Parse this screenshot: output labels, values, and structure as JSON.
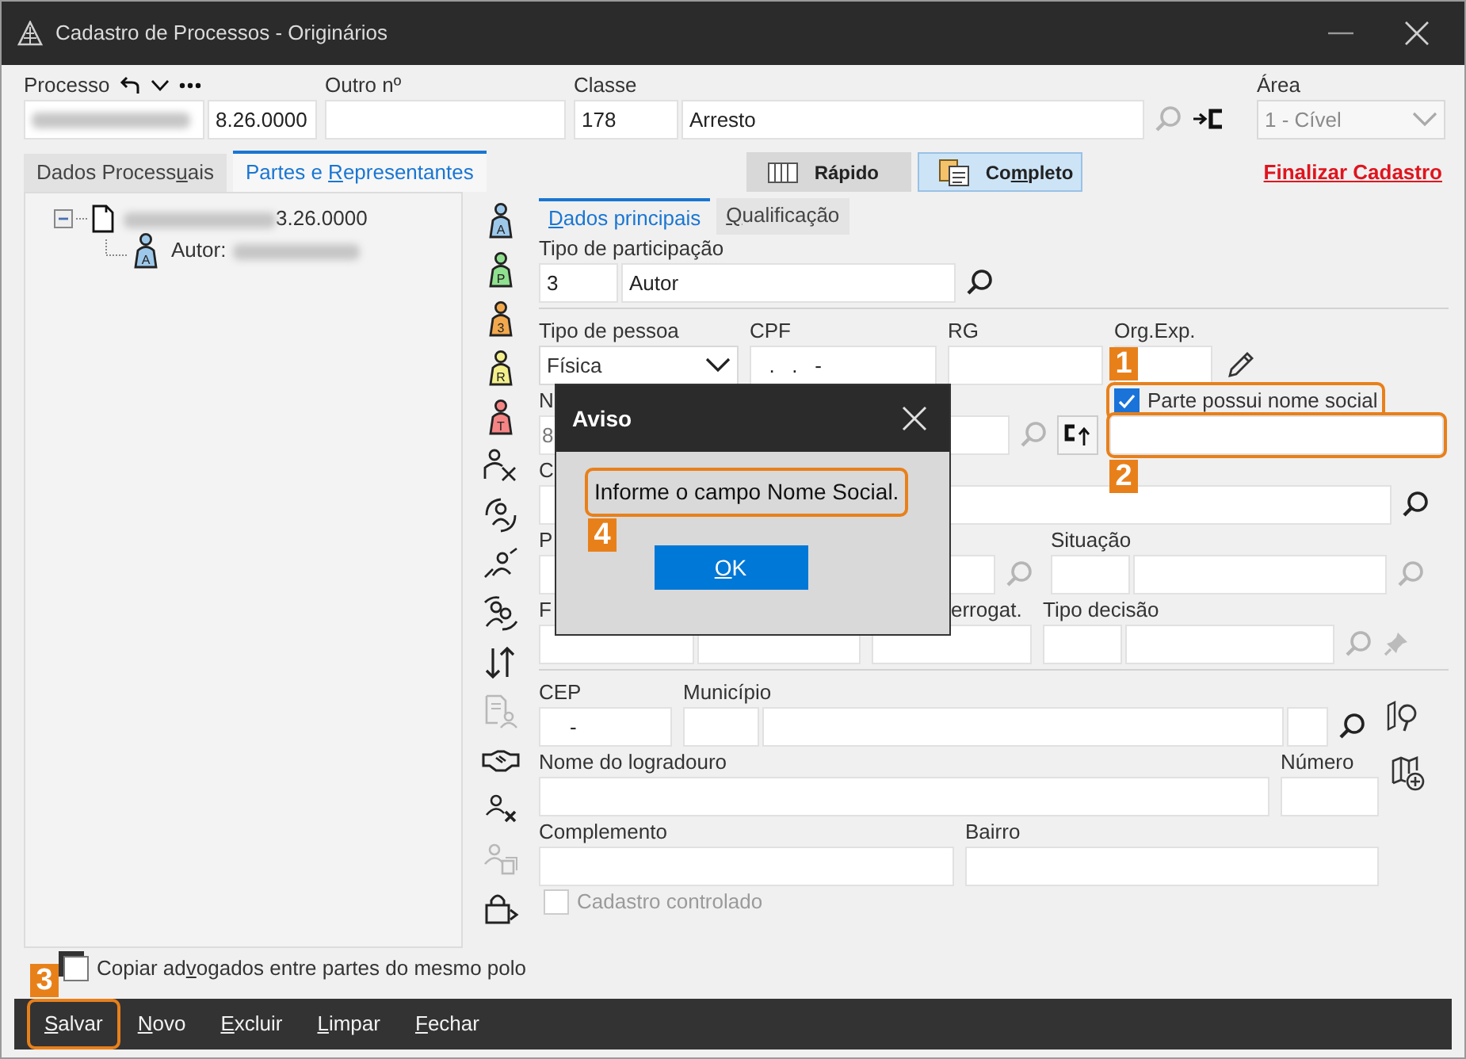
{
  "window": {
    "title": "Cadastro de Processos - Originários"
  },
  "header": {
    "groups": [
      {
        "label": "Processo",
        "tools": true,
        "controls": [
          {
            "kind": "field",
            "redacted": true
          },
          {
            "kind": "field",
            "value": "8.26.0000"
          }
        ]
      },
      {
        "label": "Outro nº",
        "controls": [
          {
            "kind": "field"
          }
        ]
      },
      {
        "label": "Classe",
        "controls": [
          {
            "kind": "field",
            "value": "178"
          },
          {
            "kind": "field",
            "value": "Arresto"
          },
          {
            "kind": "search",
            "disabled": true
          },
          {
            "kind": "link-button"
          }
        ]
      },
      {
        "label": "Área",
        "controls": [
          {
            "kind": "select",
            "value": "1 - Cível",
            "disabled": true
          }
        ]
      }
    ]
  },
  "main_tabs": [
    {
      "label": {
        "before": "Dados Process",
        "key": "u",
        "after": "ais"
      },
      "selected": false
    },
    {
      "label": {
        "before": "Partes e ",
        "key": "R",
        "after": "epresentantes"
      },
      "selected": true
    }
  ],
  "view_buttons": [
    {
      "label": {
        "before": "Rápido"
      },
      "kind": "list",
      "selected": false
    },
    {
      "label": {
        "before": "Co",
        "key": "m",
        "after": "pleto"
      },
      "kind": "cards",
      "selected": true
    }
  ],
  "finalize_link": "Finalizar Cadastro",
  "tree": [
    {
      "label": "3.26.0000",
      "redacted": true,
      "expanded": true,
      "children": [
        {
          "label": "Autor:",
          "icon_letter": "A",
          "redacted": true
        }
      ]
    }
  ],
  "side_tools": [
    {
      "kind": "pawn",
      "letter": "A",
      "color": "#9dc8ea",
      "disabled": false
    },
    {
      "kind": "pawn",
      "letter": "P",
      "color": "#8fe08f",
      "disabled": false
    },
    {
      "kind": "pawn",
      "letter": "3",
      "color": "#f2a94e",
      "disabled": false
    },
    {
      "kind": "pawn",
      "letter": "R",
      "color": "#f3f08c",
      "disabled": false
    },
    {
      "kind": "pawn",
      "letter": "T",
      "color": "#f58585",
      "disabled": false
    },
    {
      "kind": "person-x",
      "disabled": false
    },
    {
      "kind": "person-cycle",
      "disabled": false
    },
    {
      "kind": "person-arrows",
      "disabled": false
    },
    {
      "kind": "persons-swap",
      "disabled": false
    },
    {
      "kind": "sort-arrows",
      "disabled": false
    },
    {
      "kind": "doc-person",
      "disabled": true
    },
    {
      "kind": "handshake",
      "disabled": false
    },
    {
      "kind": "user-remove",
      "disabled": false
    },
    {
      "kind": "user-copy",
      "disabled": true
    },
    {
      "kind": "lock-arrow",
      "disabled": false
    }
  ],
  "sub_tabs": [
    {
      "label": {
        "key": "D",
        "after": "ados principais"
      },
      "selected": true
    },
    {
      "label": {
        "key": "Q",
        "after": "ualificação"
      },
      "selected": false
    }
  ],
  "form_rows": [
    {
      "kind": "fields",
      "groups": [
        {
          "label": "Tipo de participação",
          "controls": [
            {
              "kind": "field",
              "value": "3"
            },
            {
              "kind": "field",
              "value": "Autor"
            },
            {
              "kind": "search",
              "disabled": false
            }
          ]
        }
      ]
    },
    {
      "kind": "divider"
    },
    {
      "kind": "fields",
      "groups": [
        {
          "label": "Tipo de pessoa",
          "controls": [
            {
              "kind": "select",
              "value": "Física",
              "disabled": false
            }
          ]
        },
        {
          "label": "CPF",
          "controls": [
            {
              "kind": "field",
              "value": "  .   .   -"
            }
          ]
        },
        {
          "label": "RG",
          "controls": [
            {
              "kind": "field"
            }
          ]
        },
        {
          "label": "Org.Exp.",
          "controls": [
            {
              "kind": "field"
            },
            {
              "kind": "pencil"
            }
          ]
        }
      ]
    },
    {
      "kind": "fields",
      "groups": [
        {
          "label": "N",
          "controls": [
            {
              "kind": "field",
              "value": "8",
              "muted": true
            },
            {
              "kind": "field"
            },
            {
              "kind": "search",
              "disabled": true
            },
            {
              "kind": "tag-button"
            }
          ]
        },
        {
          "checkbox": {
            "label": "Parte possui nome social",
            "checked": true,
            "disabled": false,
            "annotation": {
              "number": "1"
            }
          },
          "controls": [
            {
              "kind": "field",
              "annotation": {
                "number": "2"
              }
            }
          ]
        }
      ]
    },
    {
      "kind": "fields",
      "groups": [
        {
          "label": "C",
          "controls": [
            {
              "kind": "field"
            },
            {
              "kind": "search",
              "disabled": false
            }
          ]
        }
      ]
    },
    {
      "kind": "fields",
      "groups": [
        {
          "label": "P",
          "controls": [
            {
              "kind": "field"
            },
            {
              "kind": "search",
              "disabled": true
            }
          ]
        },
        {
          "label": "Situação",
          "controls": [
            {
              "kind": "field"
            },
            {
              "kind": "field"
            },
            {
              "kind": "search",
              "disabled": true
            }
          ]
        }
      ]
    },
    {
      "kind": "fields",
      "groups": [
        {
          "label": "F",
          "controls": [
            {
              "kind": "field"
            },
            {
              "kind": "field"
            }
          ]
        },
        {
          "label": "errogat.",
          "controls": [
            {
              "kind": "field"
            }
          ]
        },
        {
          "label": "Tipo decisão",
          "controls": [
            {
              "kind": "field"
            },
            {
              "kind": "field"
            },
            {
              "kind": "search",
              "disabled": true
            },
            {
              "kind": "pin",
              "disabled": true
            }
          ]
        }
      ]
    },
    {
      "kind": "divider"
    },
    {
      "kind": "fields",
      "groups": [
        {
          "label": "CEP",
          "controls": [
            {
              "kind": "field",
              "value": "    -"
            }
          ]
        },
        {
          "label": "Município",
          "controls": [
            {
              "kind": "field"
            },
            {
              "kind": "field"
            },
            {
              "kind": "field"
            },
            {
              "kind": "search",
              "disabled": false
            }
          ]
        },
        {
          "controls": [
            {
              "kind": "map-pin"
            }
          ]
        }
      ]
    },
    {
      "kind": "fields",
      "groups": [
        {
          "label": "Nome do logradouro",
          "controls": [
            {
              "kind": "field"
            }
          ]
        },
        {
          "label": "Número",
          "controls": [
            {
              "kind": "field"
            }
          ]
        },
        {
          "controls": [
            {
              "kind": "map-plus"
            }
          ]
        }
      ]
    },
    {
      "kind": "fields",
      "groups": [
        {
          "label": "Complemento",
          "controls": [
            {
              "kind": "field"
            }
          ]
        },
        {
          "label": "Bairro",
          "controls": [
            {
              "kind": "field"
            }
          ]
        }
      ]
    },
    {
      "kind": "fields",
      "groups": [
        {
          "checkbox": {
            "label": "Cadastro controlado",
            "checked": false,
            "disabled": true
          }
        }
      ]
    }
  ],
  "copy_checkbox": {
    "label": {
      "before": "Copiar ad",
      "key": "v",
      "after": "ogados entre partes do mesmo polo"
    },
    "checked": false
  },
  "actions": [
    {
      "label": {
        "key": "S",
        "after": "alvar"
      },
      "annotation": {
        "number": "3"
      }
    },
    {
      "label": {
        "key": "N",
        "after": "ovo"
      }
    },
    {
      "label": {
        "key": "E",
        "after": "xcluir"
      }
    },
    {
      "label": {
        "key": "L",
        "after": "impar"
      }
    },
    {
      "label": {
        "key": "F",
        "after": "echar"
      }
    }
  ],
  "dialog": {
    "title": "Aviso",
    "message": "Informe o campo Nome Social.",
    "annotation": {
      "number": "4"
    },
    "button": {
      "key": "O",
      "after": "K"
    }
  }
}
